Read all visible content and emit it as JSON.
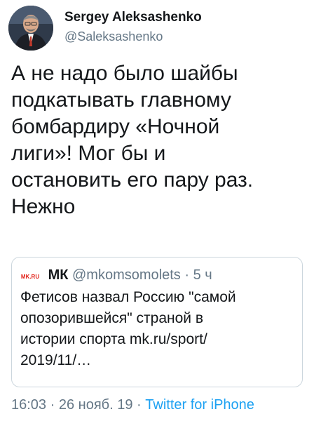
{
  "author": {
    "display_name": "Sergey Aleksashenko",
    "handle": "@Saleksashenko"
  },
  "tweet": {
    "text": "А не надо было шайбы\nподкатывать главному\nбомбардиру «Ночной\nлиги»! Мог бы и\nостановить его пару раз.\nНежно"
  },
  "quoted": {
    "name": "МК",
    "handle": "@mkomsomolets",
    "separator": "·",
    "time": "5 ч",
    "text": "Фетисов назвал Россию \"самой\nопозорившейся\" страной в\nистории спорта mk.ru/sport/\n2019/11/…",
    "logo_text": "MK.RU"
  },
  "footer": {
    "time": "16:03",
    "sep1": "·",
    "date": "26 нояб. 19",
    "sep2": "·",
    "source": "Twitter for iPhone"
  },
  "colors": {
    "text": "#14171a",
    "muted": "#657786",
    "link": "#1da1f2",
    "border": "#ccd6dd",
    "logo_red": "#e2231a"
  }
}
